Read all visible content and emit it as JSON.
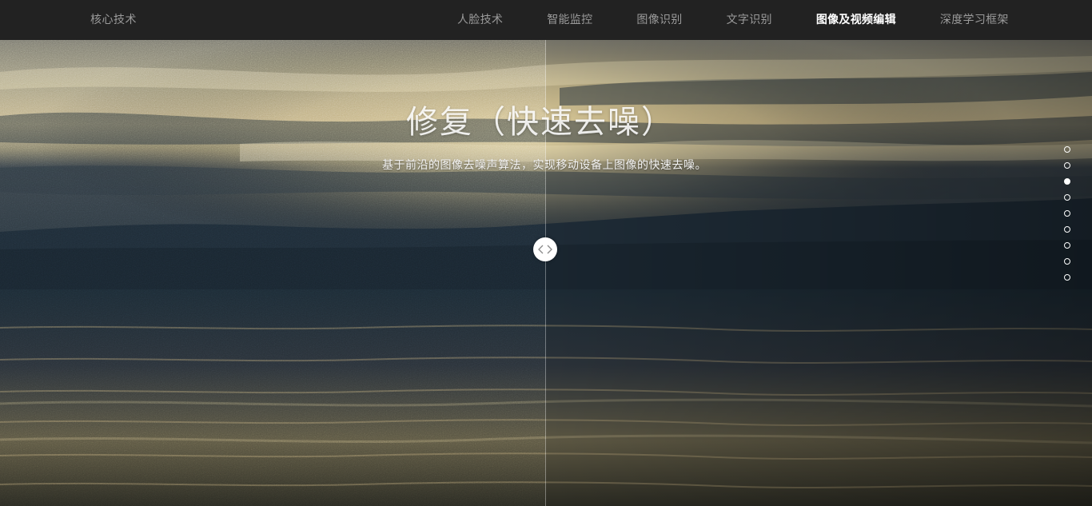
{
  "header": {
    "brand": "核心技术",
    "nav": [
      {
        "label": "人脸技术",
        "active": false
      },
      {
        "label": "智能监控",
        "active": false
      },
      {
        "label": "图像识别",
        "active": false
      },
      {
        "label": "文字识别",
        "active": false
      },
      {
        "label": "图像及视频编辑",
        "active": true
      },
      {
        "label": "深度学习框架",
        "active": false
      }
    ]
  },
  "hero": {
    "title": "修复（快速去噪）",
    "subtitle": "基于前沿的图像去噪声算法，实现移动设备上图像的快速去噪。",
    "handle_icon": "chevron-left-right-icon"
  },
  "pagination": {
    "count": 9,
    "active_index": 2
  },
  "colors": {
    "topbar": "#222222",
    "nav_text": "#9a9a9a",
    "nav_active": "#ffffff",
    "sky_warm": "#c9b98f",
    "water_dark": "#1d2a33"
  }
}
